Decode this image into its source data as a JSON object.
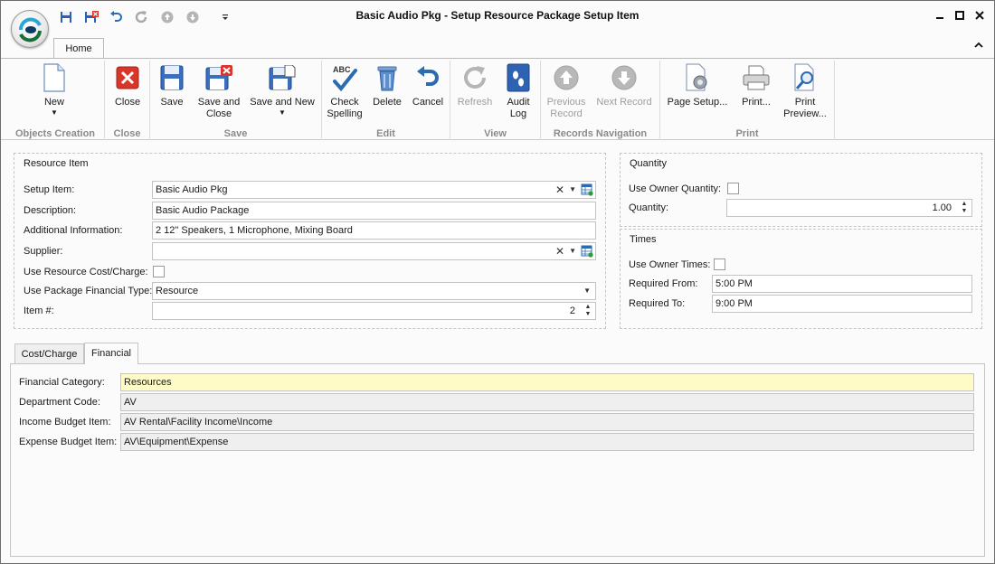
{
  "window": {
    "title": "Basic Audio Pkg - Setup Resource Package Setup Item",
    "minimize": "▁",
    "maximize": "▢",
    "close": "✕"
  },
  "quick_access": [
    "save-icon",
    "save-close-icon",
    "undo-icon",
    "redo-icon",
    "up-icon",
    "down-icon",
    "customize-icon"
  ],
  "ribbon": {
    "tab": "Home",
    "groups": {
      "objects_creation": "Objects Creation",
      "close": "Close",
      "save": "Save",
      "edit": "Edit",
      "view": "View",
      "records_navigation": "Records Navigation",
      "print": "Print"
    },
    "buttons": {
      "new": "New",
      "close": "Close",
      "save": "Save",
      "save_and_close_1": "Save and",
      "save_and_close_2": "Close",
      "save_and_new": "Save and New",
      "check_spelling_1": "Check",
      "check_spelling_2": "Spelling",
      "check_spelling_badge": "ABC",
      "delete": "Delete",
      "cancel": "Cancel",
      "refresh": "Refresh",
      "audit_log_1": "Audit",
      "audit_log_2": "Log",
      "previous_record_1": "Previous",
      "previous_record_2": "Record",
      "next_record": "Next Record",
      "page_setup": "Page Setup...",
      "print": "Print...",
      "print_preview_1": "Print",
      "print_preview_2": "Preview..."
    }
  },
  "resource_item": {
    "title": "Resource Item",
    "setup_item": {
      "label": "Setup Item:",
      "value": "Basic Audio Pkg"
    },
    "description": {
      "label": "Description:",
      "value": "Basic Audio Package"
    },
    "additional_information": {
      "label": "Additional Information:",
      "value": "2 12\" Speakers, 1 Microphone, Mixing Board"
    },
    "supplier": {
      "label": "Supplier:",
      "value": ""
    },
    "use_resource_cost_charge": {
      "label": "Use Resource Cost/Charge:",
      "checked": false
    },
    "use_package_financial_type": {
      "label": "Use Package Financial Type:",
      "value": "Resource"
    },
    "item_number": {
      "label": "Item #:",
      "value": "2"
    }
  },
  "quantity": {
    "title": "Quantity",
    "use_owner_quantity": {
      "label": "Use Owner Quantity:",
      "checked": false
    },
    "quantity": {
      "label": "Quantity:",
      "value": "1.00"
    }
  },
  "times": {
    "title": "Times",
    "use_owner_times": {
      "label": "Use Owner Times:",
      "checked": false
    },
    "required_from": {
      "label": "Required From:",
      "value": "5:00 PM"
    },
    "required_to": {
      "label": "Required To:",
      "value": "9:00 PM"
    }
  },
  "bottom_tabs": {
    "cost_charge": "Cost/Charge",
    "financial": "Financial",
    "active": "Financial"
  },
  "financial": {
    "financial_category": {
      "label": "Financial Category:",
      "value": "Resources"
    },
    "department_code": {
      "label": "Department Code:",
      "value": "AV"
    },
    "income_budget_item": {
      "label": "Income Budget Item:",
      "value": "AV Rental\\Facility Income\\Income"
    },
    "expense_budget_item": {
      "label": "Expense Budget Item:",
      "value": "AV\\Equipment\\Expense"
    }
  },
  "colors": {
    "highlight_field": "#fefbc6",
    "readonly_field": "#efefef",
    "close_red": "#d9362b",
    "accent_blue": "#2b6cb0"
  }
}
